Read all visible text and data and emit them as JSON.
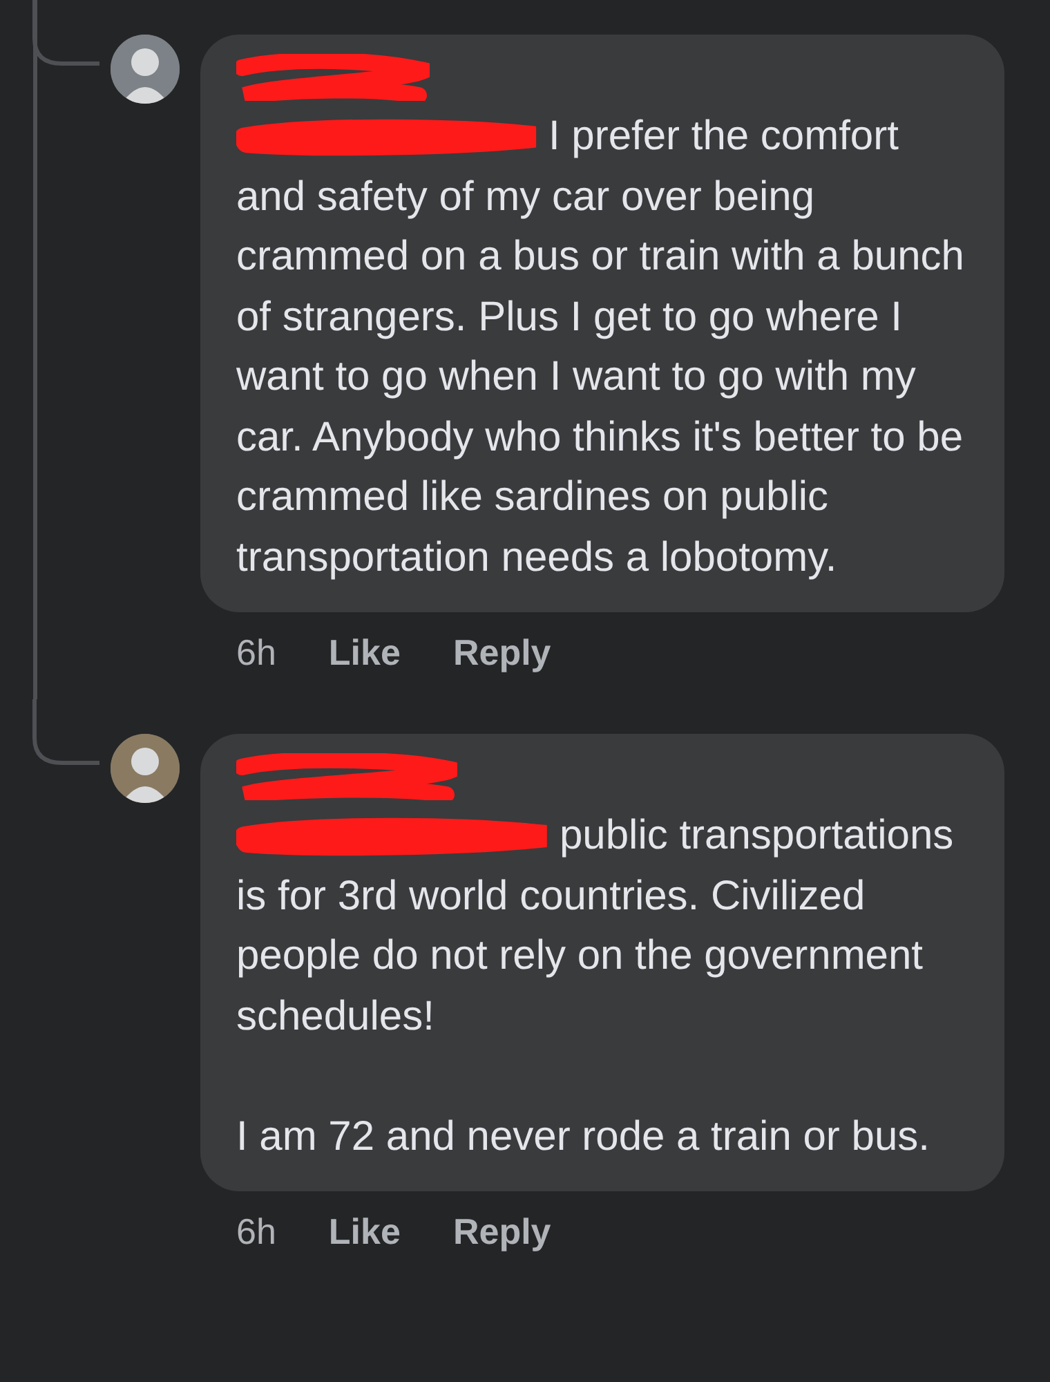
{
  "comments": [
    {
      "paragraphs": [
        "I prefer the comfort and safety of my car over being crammed on a bus or train with a bunch of strangers. Plus I get to go where I want to go when I want to go with my car. Anybody who thinks it's better to be crammed like sardines on public transportation needs a lobotomy."
      ],
      "time": "6h",
      "like": "Like",
      "reply": "Reply"
    },
    {
      "paragraphs": [
        "public transportations is for 3rd world countries. Civilized people do not rely on the government schedules!",
        "I am 72 and never rode a train or bus."
      ],
      "time": "6h",
      "like": "Like",
      "reply": "Reply"
    }
  ]
}
